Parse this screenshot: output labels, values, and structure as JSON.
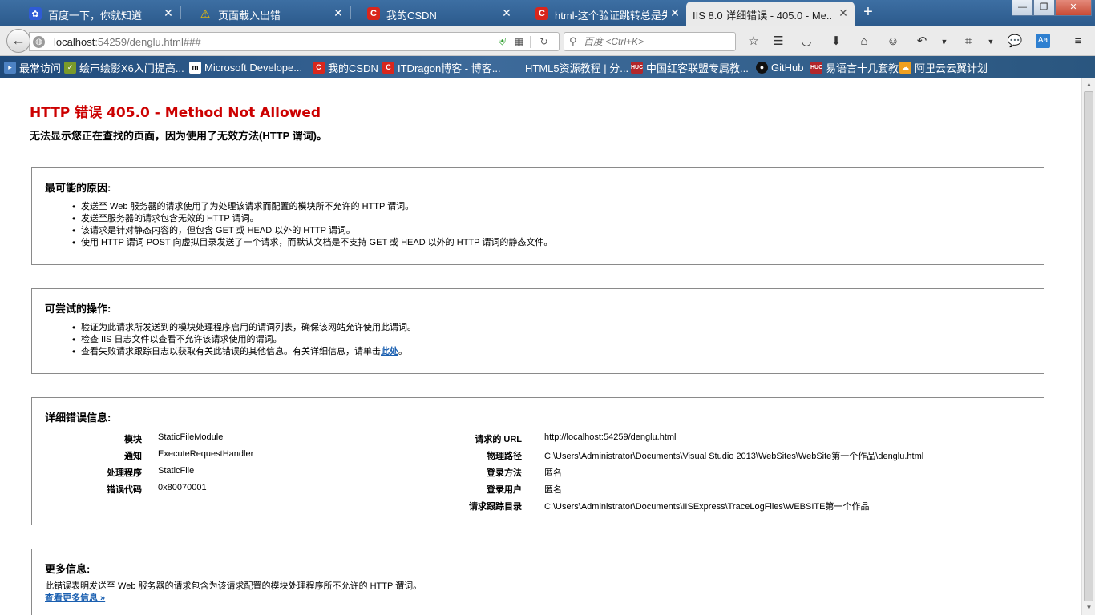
{
  "window": {
    "tabs": [
      {
        "label": "百度一下，你就知道",
        "icon": "baidu-paw-icon",
        "active": false
      },
      {
        "label": "页面载入出错",
        "icon": "warning-icon",
        "active": false
      },
      {
        "label": "我的CSDN",
        "icon": "csdn-logo-icon",
        "active": false
      },
      {
        "label": "html-这个验证跳转总是失...",
        "icon": "csdn-logo-icon",
        "active": false
      },
      {
        "label": "IIS 8.0 详细错误 - 405.0 - Me...",
        "icon": "",
        "active": true
      }
    ],
    "new_tab": "+",
    "controls": {
      "minimize": "—",
      "maximize": "❐",
      "close": "✕"
    }
  },
  "nav": {
    "url_host": "localhost",
    "url_rest": ":54259/denglu.html###",
    "search_placeholder": "百度 <Ctrl+K>"
  },
  "bookmarks": [
    {
      "label": "最常访问",
      "icon": "folder-icon"
    },
    {
      "label": "绘声绘影X6入门提高...",
      "icon": "bookmark-icon"
    },
    {
      "label": "Microsoft Develope...",
      "icon": "m-logo-icon"
    },
    {
      "label": "我的CSDN",
      "icon": "csdn-logo-icon"
    },
    {
      "label": "ITDragon博客 - 博客...",
      "icon": "csdn-logo-icon"
    },
    {
      "label": "HTML5资源教程 | 分...",
      "icon": ""
    },
    {
      "label": "中国红客联盟专属教...",
      "icon": "huc-logo-icon"
    },
    {
      "label": "GitHub",
      "icon": "github-icon"
    },
    {
      "label": "易语言十几套教",
      "icon": "huc-logo-icon"
    },
    {
      "label": "阿里云云翼计划",
      "icon": "aliyun-icon"
    }
  ],
  "page": {
    "title": "HTTP 错误 405.0 - Method Not Allowed",
    "subtitle": "无法显示您正在查找的页面，因为使用了无效方法(HTTP 谓词)。",
    "causes": {
      "heading": "最可能的原因:",
      "items": [
        "发送至 Web 服务器的请求使用了为处理该请求而配置的模块所不允许的 HTTP 谓词。",
        "发送至服务器的请求包含无效的 HTTP 谓词。",
        "该请求是针对静态内容的，但包含 GET 或 HEAD 以外的 HTTP 谓词。",
        "使用 HTTP 谓词 POST 向虚拟目录发送了一个请求，而默认文档是不支持 GET 或 HEAD 以外的 HTTP 谓词的静态文件。"
      ]
    },
    "actions": {
      "heading": "可尝试的操作:",
      "items": [
        "验证为此请求所发送到的模块处理程序启用的谓词列表，确保该网站允许使用此谓词。",
        "检查 IIS 日志文件以查看不允许该请求使用的谓词。"
      ],
      "last_item_text": "查看失败请求跟踪日志以获取有关此错误的其他信息。有关详细信息，请单击",
      "last_item_link": "此处",
      "last_item_end": "。"
    },
    "details": {
      "heading": "详细错误信息:",
      "left": [
        {
          "label": "模块",
          "value": "StaticFileModule"
        },
        {
          "label": "通知",
          "value": "ExecuteRequestHandler"
        },
        {
          "label": "处理程序",
          "value": "StaticFile"
        },
        {
          "label": "错误代码",
          "value": "0x80070001"
        }
      ],
      "right": [
        {
          "label": "请求的 URL",
          "value": "http://localhost:54259/denglu.html"
        },
        {
          "label": "物理路径",
          "value": "C:\\Users\\Administrator\\Documents\\Visual Studio 2013\\WebSites\\WebSite第一个作品\\denglu.html"
        },
        {
          "label": "登录方法",
          "value": "匿名"
        },
        {
          "label": "登录用户",
          "value": "匿名"
        },
        {
          "label": "请求跟踪目录",
          "value": "C:\\Users\\Administrator\\Documents\\IISExpress\\TraceLogFiles\\WEBSITE第一个作品"
        }
      ]
    },
    "more": {
      "heading": "更多信息:",
      "text": "此错误表明发送至 Web 服务器的请求包含为该请求配置的模块处理程序所不允许的 HTTP 谓词。",
      "link": "查看更多信息 »"
    }
  },
  "colors": {
    "title_red": "#cc0000",
    "link_blue": "#1a5fb0",
    "chrome_blue": "#2c5a8c"
  }
}
